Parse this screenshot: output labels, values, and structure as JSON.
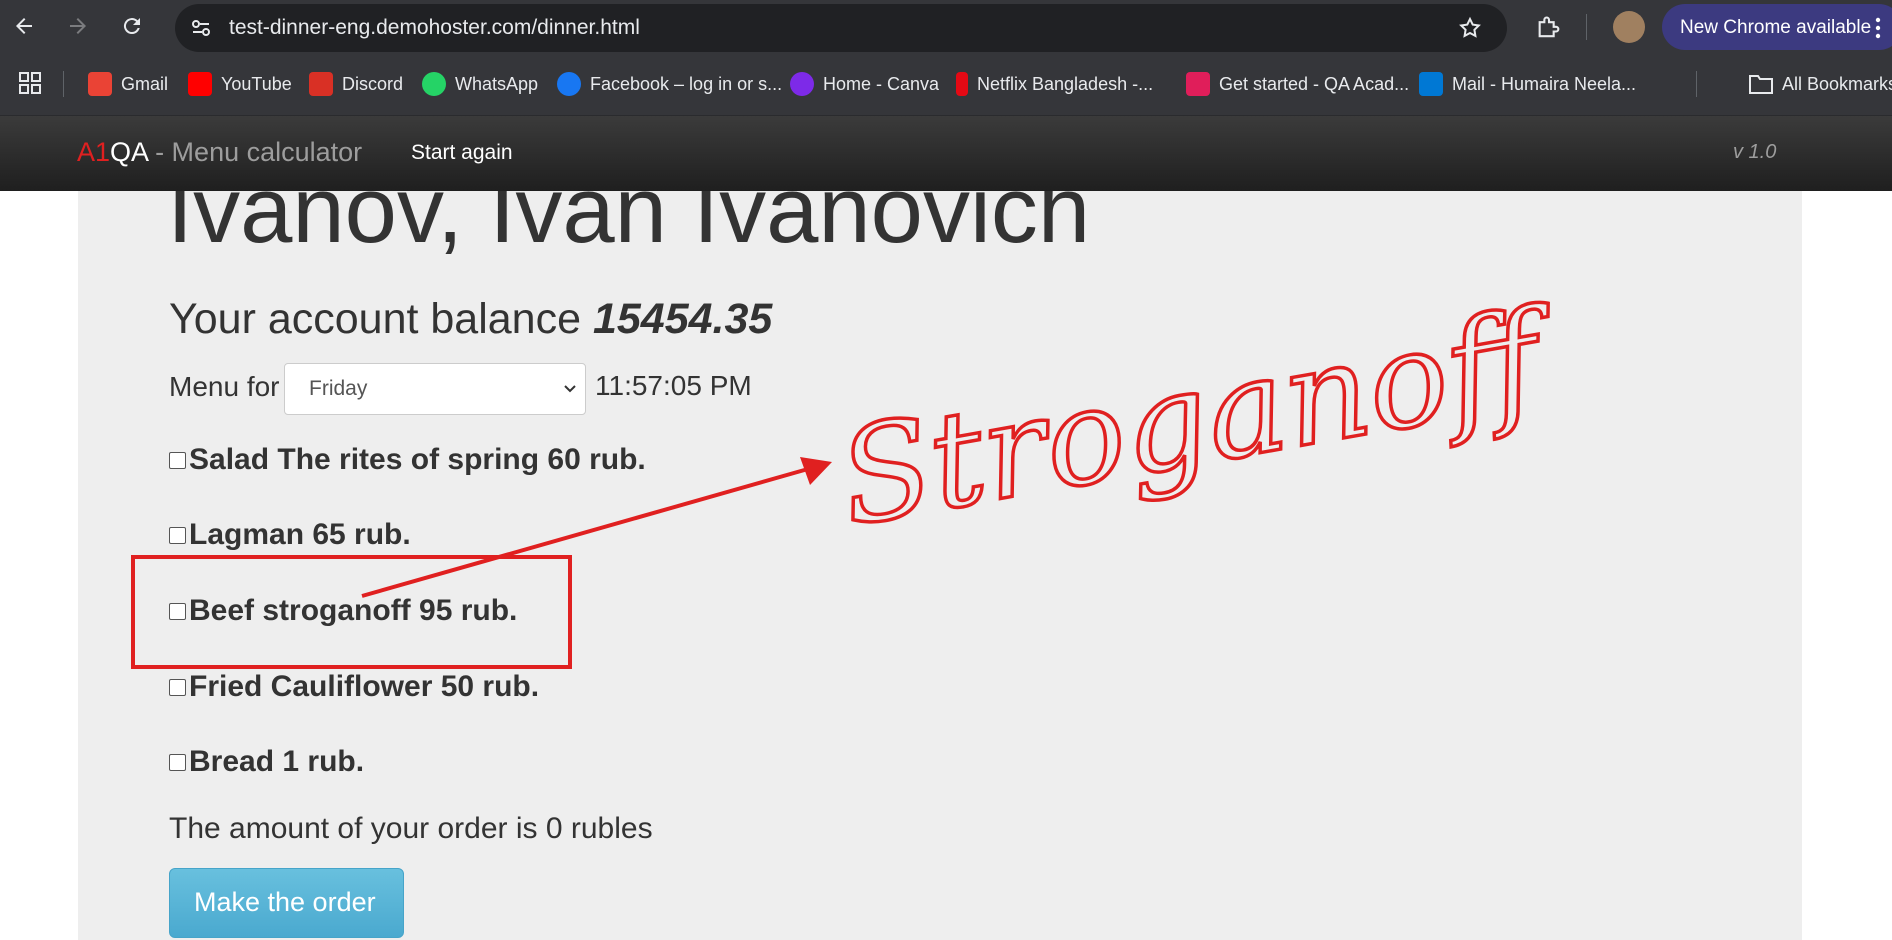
{
  "browser": {
    "url": "test-dinner-eng.demohoster.com/dinner.html",
    "update_label": "New Chrome available",
    "bookmarks": [
      {
        "label": "Gmail",
        "color": "#ea4335"
      },
      {
        "label": "YouTube",
        "color": "#ff0000"
      },
      {
        "label": "Discord",
        "color": "#d93025"
      },
      {
        "label": "WhatsApp",
        "color": "#25d366"
      },
      {
        "label": "Facebook – log in or s...",
        "color": "#1877f2"
      },
      {
        "label": "Home - Canva",
        "color": "#7d2ae8"
      },
      {
        "label": "Netflix Bangladesh -...",
        "color": "#e50914"
      },
      {
        "label": "Get started - QA Acad...",
        "color": "#e01e5a"
      },
      {
        "label": "Mail - Humaira Neela...",
        "color": "#0078d4"
      }
    ],
    "all_bookmarks_label": "All Bookmarks"
  },
  "navbar": {
    "brand_a1": "A1",
    "brand_qa": "QA",
    "brand_rest": " - Menu calculator",
    "start_again": "Start again",
    "version": "v 1.0"
  },
  "page": {
    "user_name": "Ivanov, Ivan Ivanovich",
    "balance_label": "Your account balance ",
    "balance_value": "15454.35",
    "menu_for_label": "Menu for",
    "selected_day": "Friday",
    "clock": "11:57:05 PM",
    "dishes": [
      "Salad The rites of spring 60 rub.",
      "Lagman 65 rub.",
      "Beef stroganoff 95 rub.",
      "Fried Cauliflower 50 rub.",
      "Bread 1 rub."
    ],
    "order_total": "The amount of your order is 0 rubles",
    "order_button": "Make the order"
  },
  "annotation": {
    "handwritten_text": "Stroganoff",
    "color": "#e02020"
  }
}
